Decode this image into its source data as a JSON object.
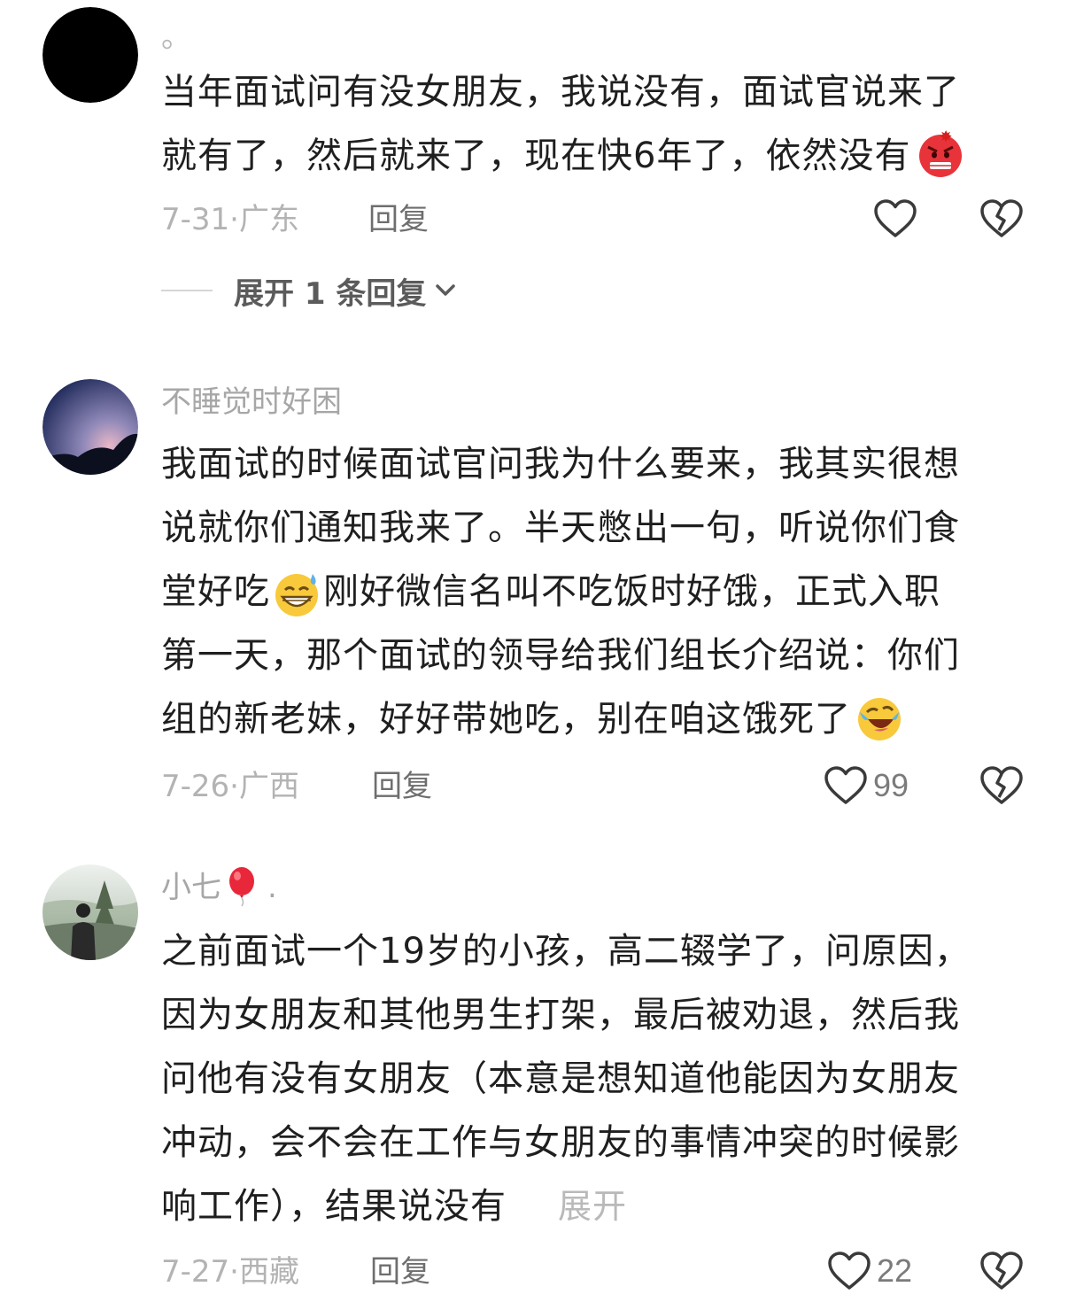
{
  "comments": [
    {
      "user": "。",
      "lines": [
        "当年面试问有没女朋友，我说没有，面试官说来了",
        "就有了，然后就来了，现在快6年了，依然没有"
      ],
      "date": "7-31",
      "dot": "·",
      "location": "广东",
      "reply_label": "回复",
      "likes": "",
      "emoji_end": "angry-face-emoji",
      "expand_replies": "展开 1 条回复"
    },
    {
      "user": "不睡觉时好困",
      "lines": [
        "我面试的时候面试官问我为什么要来，我其实很想",
        "说就你们通知我来了。半天憋出一句，听说你们食",
        "堂好吃",
        "刚好微信名叫不吃饭时好饿，正式入职",
        "第一天，那个面试的领导给我们组长介绍说：你们",
        "组的新老妹，好好带她吃，别在咱这饿死了"
      ],
      "date": "7-26",
      "dot": "·",
      "location": "广西",
      "reply_label": "回复",
      "likes": "99",
      "emoji_mid": "grinning-sweat-emoji",
      "emoji_end": "rolling-laugh-emoji"
    },
    {
      "user": "小七",
      "user_suffix": ".",
      "lines": [
        "之前面试一个19岁的小孩，高二辍学了，问原因，",
        "因为女朋友和其他男生打架，最后被劝退，然后我",
        "问他有没有女朋友（本意是想知道他能因为女朋友",
        "冲动，会不会在工作与女朋友的事情冲突的时候影",
        "响工作），结果说没有"
      ],
      "expand_label": "展开",
      "date": "7-27",
      "dot": "·",
      "location": "西藏",
      "reply_label": "回复",
      "likes": "22"
    }
  ],
  "colors": {
    "text": "#1f1f1f",
    "muted": "#b3b3b3",
    "reply": "#6e6e6e",
    "icon": "#3a3a3a"
  }
}
